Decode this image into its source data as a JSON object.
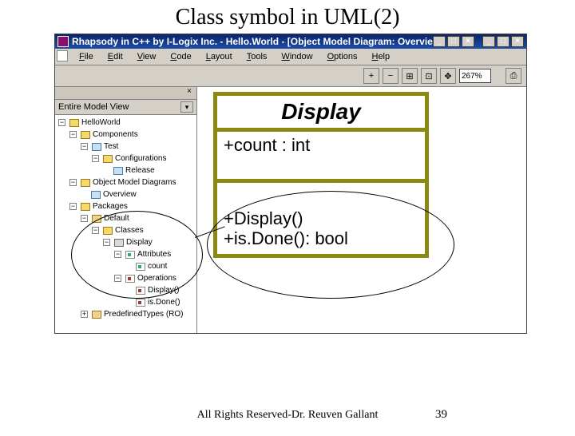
{
  "slide": {
    "title": "Class symbol in UML(2)",
    "footer": "All Rights Reserved-Dr. Reuven Gallant",
    "page": "39"
  },
  "window": {
    "title": "Rhapsody in C++ by I-Logix Inc. - Hello.World - [Object Model Diagram: Overview *]",
    "btn_min": "_",
    "btn_max": "□",
    "btn_close": "×"
  },
  "menu": {
    "file": "File",
    "edit": "Edit",
    "view": "View",
    "code": "Code",
    "layout": "Layout",
    "tools": "Tools",
    "window": "Window",
    "options": "Options",
    "help": "Help"
  },
  "toolbar": {
    "zoom_in": "+",
    "zoom_out": "−",
    "fit": "⊞",
    "actual": "⊡",
    "pan": "✥",
    "zoom_value": "267%",
    "print": "⎙"
  },
  "sidebar": {
    "close": "×",
    "view_label": "Entire Model View",
    "caret": "▾"
  },
  "tree": {
    "root": "HelloWorld",
    "components": "Components",
    "test": "Test",
    "configurations": "Configurations",
    "release": "Release",
    "omd": "Object Model Diagrams",
    "overview": "Overview",
    "packages": "Packages",
    "default": "Default",
    "classes": "Classes",
    "display_class": "Display",
    "attributes": "Attributes",
    "count_attr": "count",
    "operations": "Operations",
    "display_op": "Display()",
    "isdone_op": "is.Done()",
    "predefined": "PredefinedTypes (RO)",
    "minus": "−",
    "plus": "+"
  },
  "uml": {
    "class_name": "Display",
    "attr1": "+count : int",
    "op1": "+Display()",
    "op2": "+is.Done(): bool"
  }
}
